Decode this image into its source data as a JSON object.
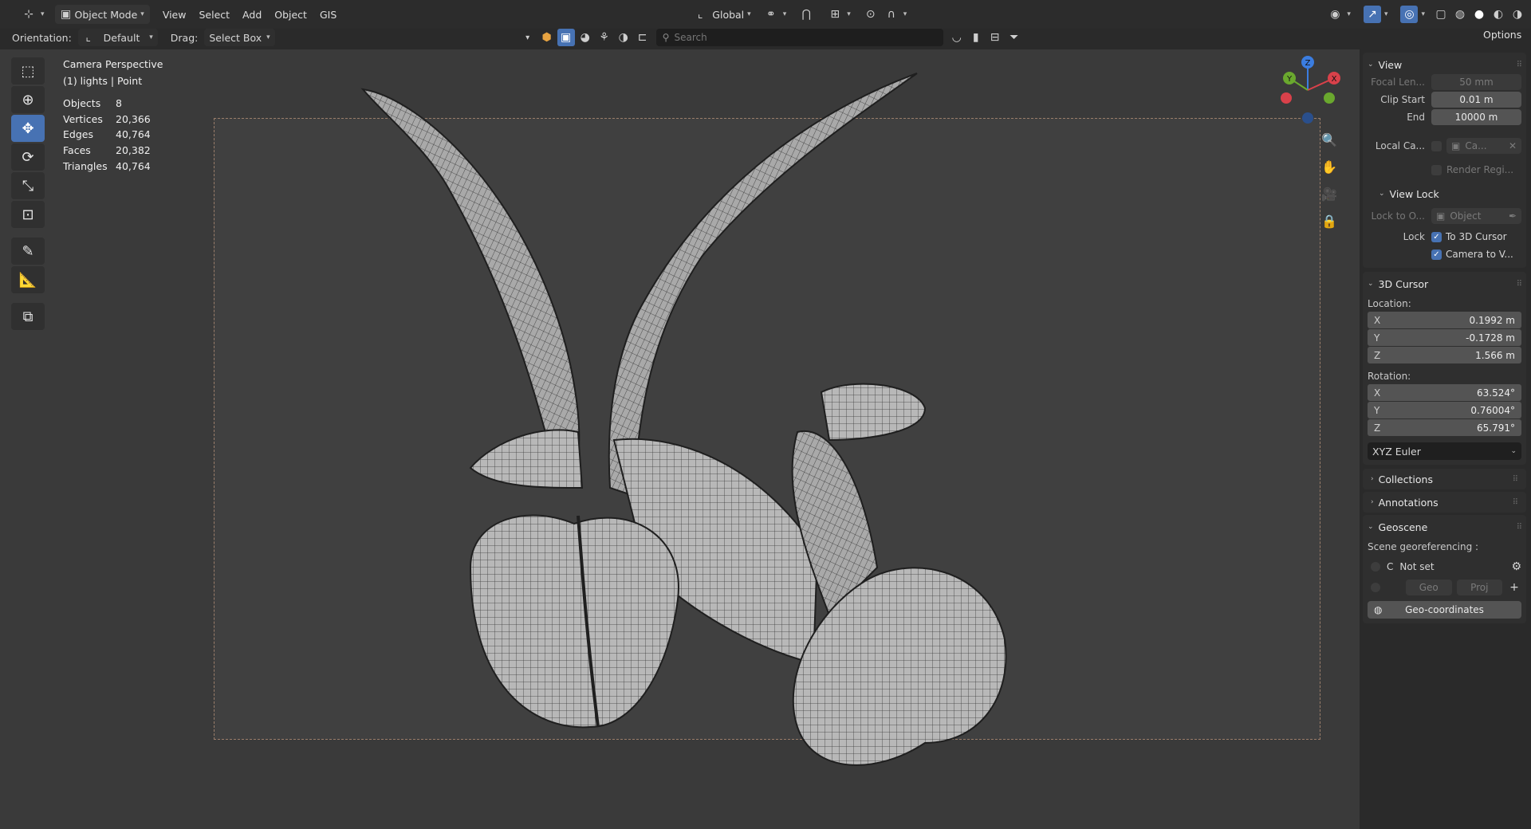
{
  "header": {
    "mode": "Object Mode",
    "menu": [
      "View",
      "Select",
      "Add",
      "Object",
      "GIS"
    ],
    "transform_orientation": "Global",
    "orientation_label": "Orientation:",
    "orientation_value": "Default",
    "drag_label": "Drag:",
    "drag_value": "Select Box",
    "search_placeholder": "Search",
    "options_label": "Options"
  },
  "viewport": {
    "camera_title": "Camera Perspective",
    "collection_info": "(1) lights | Point",
    "stats": [
      {
        "label": "Objects",
        "value": "8"
      },
      {
        "label": "Vertices",
        "value": "20,366"
      },
      {
        "label": "Edges",
        "value": "40,764"
      },
      {
        "label": "Faces",
        "value": "20,382"
      },
      {
        "label": "Triangles",
        "value": "40,764"
      }
    ],
    "gizmo_axes": {
      "z": "Z",
      "y": "Y",
      "x": "X"
    }
  },
  "npanel": {
    "view": {
      "title": "View",
      "focal_length_label": "Focal Len...",
      "focal_length_value": "50 mm",
      "clip_start_label": "Clip Start",
      "clip_start_value": "0.01 m",
      "clip_end_label": "End",
      "clip_end_value": "10000 m",
      "local_camera_label": "Local Ca...",
      "local_camera_value": "Ca...",
      "render_region_label": "Render Regi...",
      "view_lock_title": "View Lock",
      "lock_to_object_label": "Lock to O...",
      "lock_to_object_placeholder": "Object",
      "lock_label": "Lock",
      "lock_to_cursor_label": "To 3D Cursor",
      "camera_to_view_label": "Camera to V..."
    },
    "cursor": {
      "title": "3D Cursor",
      "location_label": "Location:",
      "location": [
        {
          "axis": "X",
          "value": "0.1992 m"
        },
        {
          "axis": "Y",
          "value": "-0.1728 m"
        },
        {
          "axis": "Z",
          "value": "1.566 m"
        }
      ],
      "rotation_label": "Rotation:",
      "rotation": [
        {
          "axis": "X",
          "value": "63.524°"
        },
        {
          "axis": "Y",
          "value": "0.76004°"
        },
        {
          "axis": "Z",
          "value": "65.791°"
        }
      ],
      "rotation_mode": "XYZ Euler"
    },
    "collections_title": "Collections",
    "annotations_title": "Annotations",
    "geoscene": {
      "title": "Geoscene",
      "georef_label": "Scene georeferencing :",
      "crs_letter": "C",
      "crs_value": "Not set",
      "geo_label": "Geo",
      "proj_label": "Proj",
      "geocoords_label": "Geo-coordinates"
    }
  },
  "colors": {
    "accent": "#4772b3",
    "axis_x": "#d9414a",
    "axis_y": "#6aa82e",
    "axis_z": "#3b7de0"
  }
}
